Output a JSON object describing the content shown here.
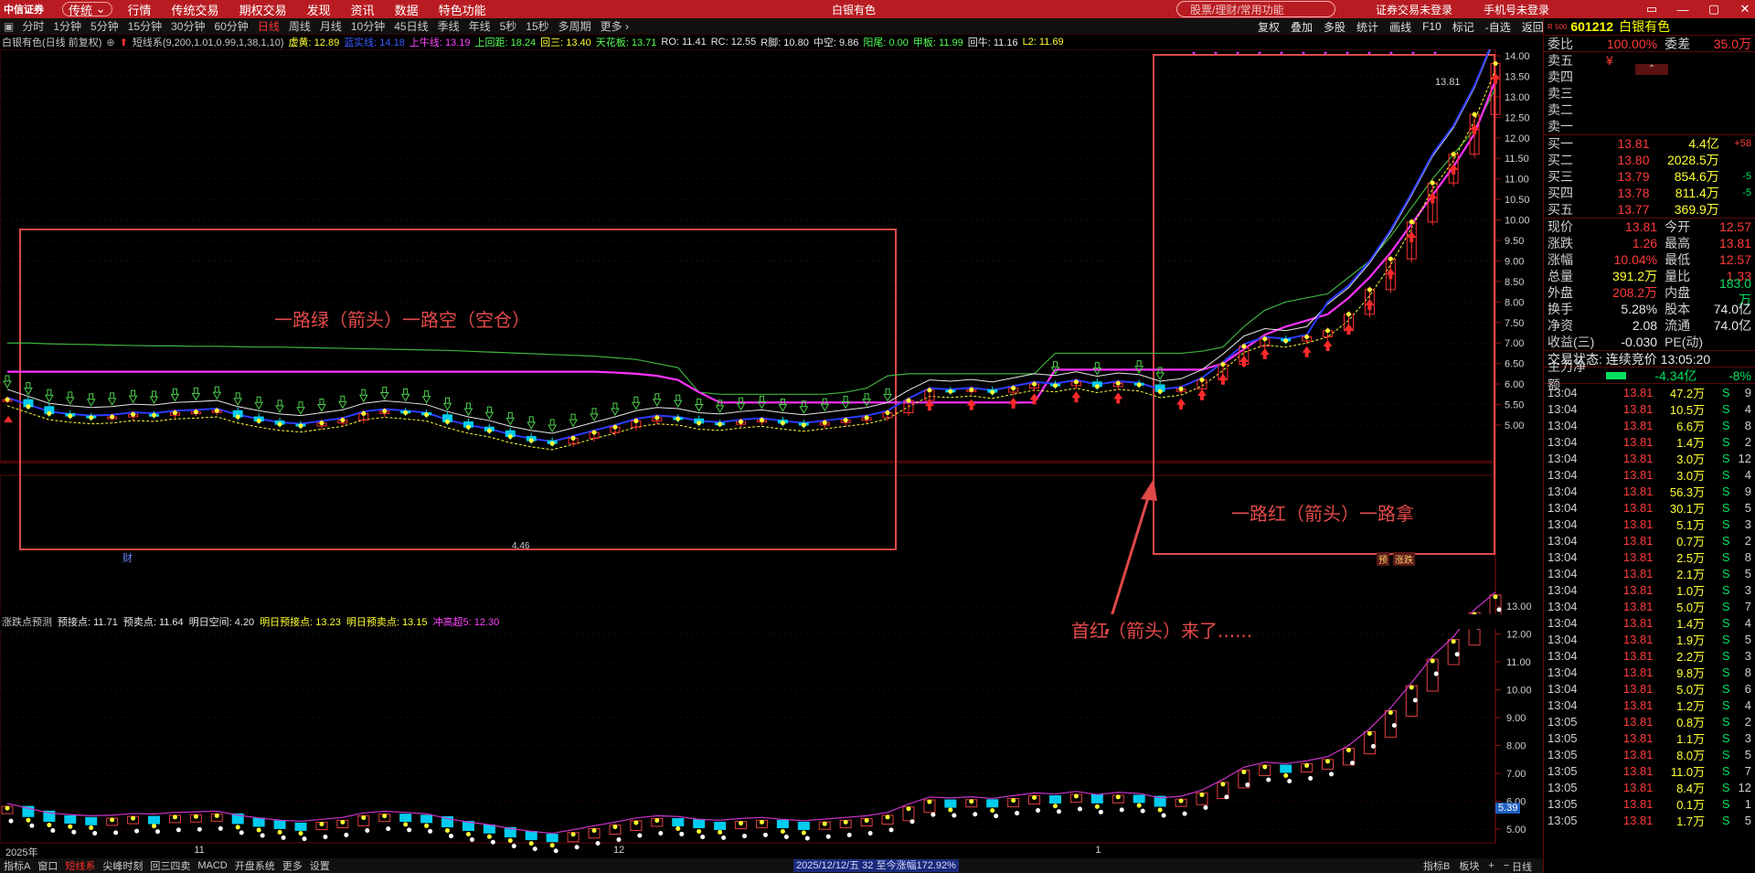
{
  "topbar": {
    "logo": "中信证券",
    "mode": "传统",
    "menus": [
      "行情",
      "传统交易",
      "期权交易",
      "发现",
      "资讯",
      "数据",
      "特色功能"
    ],
    "stock_title": "白银有色",
    "search_placeholder": "股票/理财/常用功能",
    "login": "证券交易未登录",
    "phone": "手机号未登录",
    "window_controls": [
      "▭",
      "—",
      "▢",
      "✕"
    ]
  },
  "periods": [
    "分时",
    "1分钟",
    "5分钟",
    "15分钟",
    "30分钟",
    "60分钟",
    "日线",
    "周线",
    "月线",
    "10分钟",
    "45日线",
    "季线",
    "年线",
    "5秒",
    "15秒",
    "多周期",
    "更多 ›"
  ],
  "active_period": "日线",
  "toolbar_right": [
    "复权",
    "叠加",
    "多股",
    "统计",
    "画线",
    "F10",
    "标记",
    "-自选",
    "返回"
  ],
  "indicator_bar": [
    {
      "t": "白银有色(日线 前复权)",
      "c": "#c8c8c8"
    },
    {
      "t": "短线系(9,200,1.01,0.99,1,38,1,10)",
      "c": "#c8c8c8"
    },
    {
      "t": "虚黄: 12.89",
      "c": "#ffff33"
    },
    {
      "t": "蓝实线: 14.18",
      "c": "#3a5cff"
    },
    {
      "t": "上牛线: 13.19",
      "c": "#ff44ff"
    },
    {
      "t": "上回距: 18.24",
      "c": "#55ff55"
    },
    {
      "t": "回三: 13.40",
      "c": "#ffff33"
    },
    {
      "t": "天花板: 13.71",
      "c": "#55ff55"
    },
    {
      "t": "RO: 11.41",
      "c": "#e8e8e8"
    },
    {
      "t": "RC: 12.55",
      "c": "#e8e8e8"
    },
    {
      "t": "R脚: 10.80",
      "c": "#e8e8e8"
    },
    {
      "t": "中空: 9.86",
      "c": "#e8e8e8"
    },
    {
      "t": "阳尾: 0.00",
      "c": "#55ff55"
    },
    {
      "t": "甲板: 11.99",
      "c": "#55ff55"
    },
    {
      "t": "回牛: 11.16",
      "c": "#e8e8e8"
    },
    {
      "t": "L2: 11.69",
      "c": "#ffff33"
    }
  ],
  "sub_indicator": [
    {
      "t": "涨跌点预测",
      "c": "#c8c8c8"
    },
    {
      "t": "预接点: 11.71",
      "c": "#e8e8e8"
    },
    {
      "t": "预卖点: 11.64",
      "c": "#e8e8e8"
    },
    {
      "t": "明日空间: 4.20",
      "c": "#e8e8e8"
    },
    {
      "t": "明日预接点: 13.23",
      "c": "#ffff33"
    },
    {
      "t": "明日预卖点: 13.15",
      "c": "#ffff33"
    },
    {
      "t": "冲高超5: 12.30",
      "c": "#ff44ff"
    }
  ],
  "annotations": {
    "green_box": "一路绿（箭头）一路空（空仓）",
    "red_box": "一路红（箭头）一路拿",
    "first_red": "首红（箭头）来了......",
    "price_label": "13.81",
    "fin_marker": "财",
    "tags": [
      "预",
      "涨跌"
    ],
    "sub_last": "5.39",
    "low_label": "4.46"
  },
  "chart_data": {
    "type": "candlestick",
    "main_axis": {
      "ticks": [
        5.0,
        5.5,
        6.0,
        6.5,
        7.0,
        7.5,
        8.0,
        8.5,
        9.0,
        9.5,
        10.0,
        10.5,
        11.0,
        11.5,
        12.0,
        12.5,
        13.0,
        13.5,
        14.0
      ]
    },
    "sub_axis": {
      "ticks": [
        5.0,
        6.0,
        7.0,
        8.0,
        9.0,
        10.0,
        11.0,
        12.0,
        13.0
      ]
    },
    "x_labels": [
      {
        "t": "2025年",
        "i": 0
      },
      {
        "t": "11",
        "i": 9
      },
      {
        "t": "12",
        "i": 29
      },
      {
        "t": "1",
        "i": 52
      }
    ],
    "closes": [
      5.62,
      5.45,
      5.28,
      5.22,
      5.18,
      5.2,
      5.26,
      5.24,
      5.3,
      5.32,
      5.35,
      5.2,
      5.1,
      5.02,
      4.98,
      5.05,
      5.12,
      5.28,
      5.34,
      5.3,
      5.25,
      5.08,
      4.95,
      4.86,
      4.72,
      4.62,
      4.55,
      4.68,
      4.82,
      4.95,
      5.1,
      5.18,
      5.15,
      5.05,
      5.02,
      5.08,
      5.12,
      5.05,
      5.0,
      5.06,
      5.12,
      5.18,
      5.3,
      5.6,
      5.85,
      5.82,
      5.86,
      5.8,
      5.9,
      6.0,
      5.96,
      6.05,
      5.94,
      6.02,
      5.98,
      5.82,
      5.88,
      6.1,
      6.48,
      6.92,
      7.1,
      7.05,
      7.15,
      7.3,
      7.7,
      8.3,
      9.05,
      9.95,
      10.9,
      11.6,
      12.57,
      13.81
    ],
    "pink": [
      6.3,
      6.3,
      6.3,
      6.3,
      6.3,
      6.3,
      6.3,
      6.3,
      6.3,
      6.3,
      6.3,
      6.3,
      6.3,
      6.3,
      6.3,
      6.3,
      6.3,
      6.3,
      6.3,
      6.3,
      6.3,
      6.3,
      6.3,
      6.3,
      6.3,
      6.3,
      6.3,
      6.3,
      6.3,
      6.28,
      6.25,
      6.2,
      6.1,
      5.8,
      5.55,
      5.55,
      5.55,
      5.55,
      5.55,
      5.55,
      5.55,
      5.55,
      5.55,
      5.55,
      5.55,
      5.55,
      5.55,
      5.55,
      5.55,
      5.55,
      6.35,
      6.35,
      6.35,
      6.35,
      6.35,
      6.35,
      6.35,
      6.35,
      6.5,
      6.85,
      7.2,
      7.4,
      7.55,
      7.7,
      8.1,
      8.6,
      9.2,
      9.9,
      10.6,
      11.3,
      12.1,
      13.4
    ],
    "green": [
      7.0,
      7.0,
      6.98,
      6.97,
      6.96,
      6.95,
      6.94,
      6.93,
      6.93,
      6.92,
      6.92,
      6.91,
      6.9,
      6.9,
      6.89,
      6.88,
      6.87,
      6.86,
      6.85,
      6.84,
      6.83,
      6.82,
      6.8,
      6.78,
      6.76,
      6.74,
      6.72,
      6.7,
      6.68,
      6.64,
      6.6,
      6.5,
      6.4,
      5.8,
      5.75,
      5.75,
      5.75,
      5.75,
      5.75,
      5.75,
      5.8,
      5.9,
      6.2,
      6.25,
      6.25,
      6.25,
      6.25,
      6.25,
      6.25,
      6.25,
      6.75,
      6.75,
      6.75,
      6.75,
      6.75,
      6.75,
      6.75,
      6.8,
      6.9,
      7.4,
      7.8,
      8.0,
      8.1,
      8.2,
      8.6,
      9.0,
      9.6,
      10.3,
      11.0,
      11.6,
      12.2,
      13.2
    ],
    "sub_closes": [
      5.62,
      5.45,
      5.28,
      5.22,
      5.18,
      5.2,
      5.26,
      5.24,
      5.3,
      5.32,
      5.35,
      5.2,
      5.1,
      5.02,
      4.98,
      5.05,
      5.12,
      5.28,
      5.34,
      5.3,
      5.25,
      5.08,
      4.95,
      4.86,
      4.72,
      4.62,
      4.55,
      4.68,
      4.82,
      4.95,
      5.1,
      5.18,
      5.15,
      5.05,
      5.02,
      5.08,
      5.12,
      5.05,
      5.0,
      5.06,
      5.12,
      5.18,
      5.3,
      5.6,
      5.85,
      5.82,
      5.86,
      5.8,
      5.9,
      6.0,
      5.96,
      6.05,
      5.94,
      6.02,
      5.98,
      5.82,
      5.88,
      6.1,
      6.48,
      6.92,
      7.1,
      7.05,
      7.15,
      7.3,
      7.7,
      8.3,
      9.05,
      9.95,
      10.9,
      11.6,
      12.57,
      13.2
    ]
  },
  "bottombar": [
    "指标A",
    "窗口",
    "短线系",
    "尖峰时刻",
    "回三四卖",
    "MACD",
    "开盘系统",
    "更多",
    "设置"
  ],
  "bottom_active": "短线系",
  "bottom_right": [
    "指标B",
    "板块",
    "+",
    "−"
  ],
  "bottom_period": "日线",
  "date_readout": "2025/12/12/五  32 至今涨幅172.92%",
  "right": {
    "code": "601212",
    "name": "白银有色",
    "badge": "R 500",
    "weibi": {
      "label": "委比",
      "value": "100.00%",
      "label2": "委差",
      "value2": "35.0万"
    },
    "sells": [
      {
        "l": "卖五",
        "p": "¥"
      },
      {
        "l": "卖四",
        "p": ""
      },
      {
        "l": "卖三",
        "p": ""
      },
      {
        "l": "卖二",
        "p": ""
      },
      {
        "l": "卖一",
        "p": ""
      }
    ],
    "buys": [
      {
        "l": "买一",
        "p": "13.81",
        "v": "4.4亿",
        "d": "+58"
      },
      {
        "l": "买二",
        "p": "13.80",
        "v": "2028.5万",
        "d": ""
      },
      {
        "l": "买三",
        "p": "13.79",
        "v": "854.6万",
        "d": "-5"
      },
      {
        "l": "买四",
        "p": "13.78",
        "v": "811.4万",
        "d": "-5"
      },
      {
        "l": "买五",
        "p": "13.77",
        "v": "369.9万",
        "d": ""
      }
    ],
    "quote": [
      {
        "a": "现价",
        "b": "13.81",
        "bc": "red",
        "c": "今开",
        "d": "12.57",
        "dc": "red"
      },
      {
        "a": "涨跌",
        "b": "1.26",
        "bc": "red",
        "c": "最高",
        "d": "13.81",
        "dc": "red"
      },
      {
        "a": "涨幅",
        "b": "10.04%",
        "bc": "red",
        "c": "最低",
        "d": "12.57",
        "dc": "red"
      },
      {
        "a": "总量",
        "b": "391.2万",
        "bc": "yellow",
        "c": "量比",
        "d": "1.33",
        "dc": "red"
      },
      {
        "a": "外盘",
        "b": "208.2万",
        "bc": "red",
        "c": "内盘",
        "d": "183.0万",
        "dc": "green"
      },
      {
        "a": "换手",
        "b": "5.28%",
        "bc": "white",
        "c": "股本",
        "d": "74.0亿",
        "dc": "white"
      },
      {
        "a": "净资",
        "b": "2.08",
        "bc": "white",
        "c": "流通",
        "d": "74.0亿",
        "dc": "white"
      },
      {
        "a": "收益(三)",
        "b": "-0.030",
        "bc": "white",
        "c": "PE(动)",
        "d": "",
        "dc": "white"
      }
    ],
    "status": "交易状态: 连续竞价 13:05:20",
    "mainflow": {
      "label": "主力净额",
      "value": "-4.34亿",
      "pct": "-8%"
    },
    "ticks": [
      [
        "13:04",
        "13.81",
        "47.2万",
        "S",
        "9"
      ],
      [
        "13:04",
        "13.81",
        "10.5万",
        "S",
        "4"
      ],
      [
        "13:04",
        "13.81",
        "6.6万",
        "S",
        "8"
      ],
      [
        "13:04",
        "13.81",
        "1.4万",
        "S",
        "2"
      ],
      [
        "13:04",
        "13.81",
        "3.0万",
        "S",
        "12"
      ],
      [
        "13:04",
        "13.81",
        "3.0万",
        "S",
        "4"
      ],
      [
        "13:04",
        "13.81",
        "56.3万",
        "S",
        "9"
      ],
      [
        "13:04",
        "13.81",
        "30.1万",
        "S",
        "5"
      ],
      [
        "13:04",
        "13.81",
        "5.1万",
        "S",
        "3"
      ],
      [
        "13:04",
        "13.81",
        "0.7万",
        "S",
        "2"
      ],
      [
        "13:04",
        "13.81",
        "2.5万",
        "S",
        "8"
      ],
      [
        "13:04",
        "13.81",
        "2.1万",
        "S",
        "5"
      ],
      [
        "13:04",
        "13.81",
        "1.0万",
        "S",
        "3"
      ],
      [
        "13:04",
        "13.81",
        "5.0万",
        "S",
        "7"
      ],
      [
        "13:04",
        "13.81",
        "1.4万",
        "S",
        "4"
      ],
      [
        "13:04",
        "13.81",
        "1.9万",
        "S",
        "5"
      ],
      [
        "13:04",
        "13.81",
        "2.2万",
        "S",
        "3"
      ],
      [
        "13:04",
        "13.81",
        "9.8万",
        "S",
        "8"
      ],
      [
        "13:04",
        "13.81",
        "5.0万",
        "S",
        "6"
      ],
      [
        "13:04",
        "13.81",
        "1.2万",
        "S",
        "4"
      ],
      [
        "13:05",
        "13.81",
        "0.8万",
        "S",
        "2"
      ],
      [
        "13:05",
        "13.81",
        "1.1万",
        "S",
        "3"
      ],
      [
        "13:05",
        "13.81",
        "8.0万",
        "S",
        "5"
      ],
      [
        "13:05",
        "13.81",
        "11.0万",
        "S",
        "7"
      ],
      [
        "13:05",
        "13.81",
        "8.4万",
        "S",
        "12"
      ],
      [
        "13:05",
        "13.81",
        "0.1万",
        "S",
        "1"
      ],
      [
        "13:05",
        "13.81",
        "1.7万",
        "S",
        "5"
      ]
    ]
  }
}
